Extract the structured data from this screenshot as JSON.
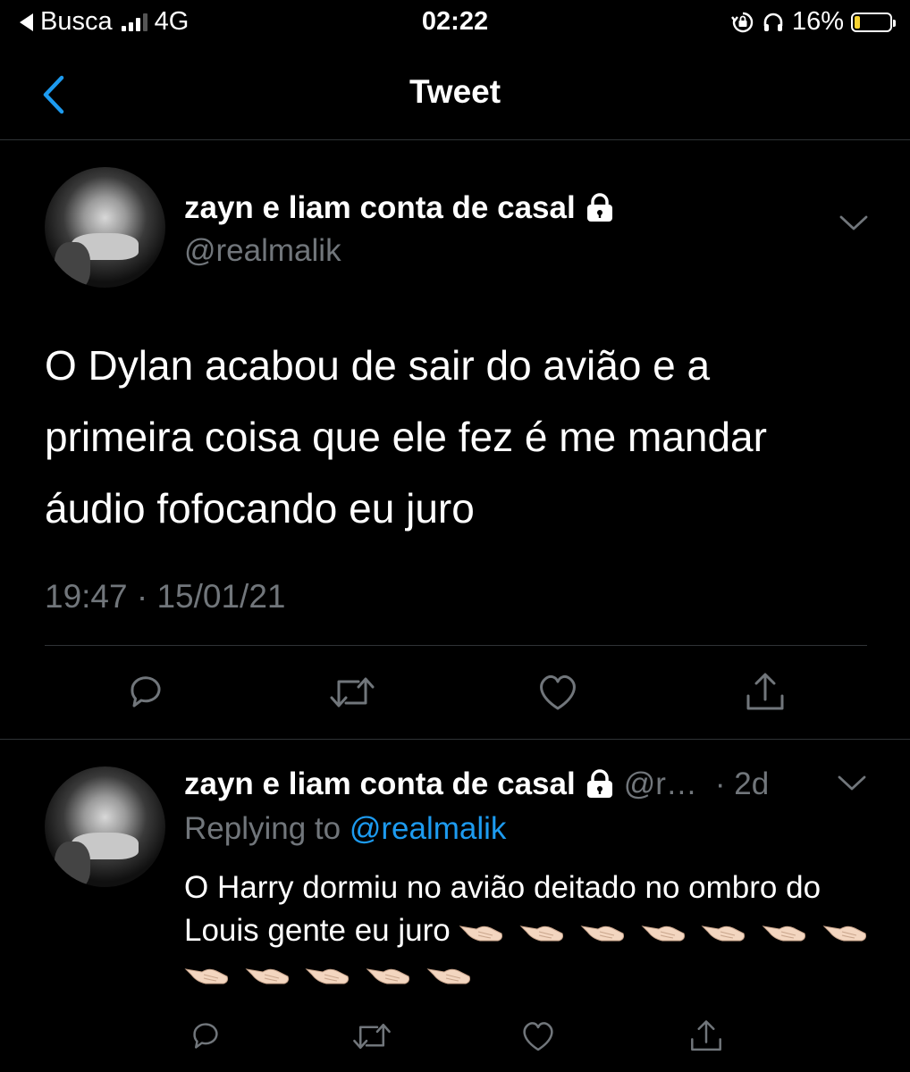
{
  "status_bar": {
    "back_app": "Busca",
    "network": "4G",
    "time": "02:22",
    "battery": "16%",
    "battery_level": 0.16
  },
  "nav": {
    "title": "Tweet"
  },
  "tweet": {
    "author_name": "zayn e liam conta de casal",
    "handle": "@realmalik",
    "text": "O Dylan acabou de sair do avião e a primeira coisa que ele fez é me mandar áudio fofocando eu juro",
    "timestamp": "19:47 · 15/01/21"
  },
  "reply": {
    "author_name": "zayn e liam conta de casal",
    "handle_truncated": "@r…",
    "age": "· 2d",
    "replying_prefix": "Replying to",
    "replying_handle": "@realmalik",
    "text": "O Harry dormiu no avião deitado no ombro do Louis gente eu juro",
    "emoji_count": 12
  },
  "icons": {
    "back": "chevron-left-icon",
    "lock": "lock-icon",
    "more": "chevron-down-icon",
    "reply": "reply-icon",
    "retweet": "retweet-icon",
    "like": "heart-icon",
    "share": "share-icon",
    "emoji": "pointing-hand-emoji"
  },
  "colors": {
    "background": "#000000",
    "accent": "#1d9bf0",
    "secondary_text": "#71767b",
    "battery": "#f6d232"
  }
}
